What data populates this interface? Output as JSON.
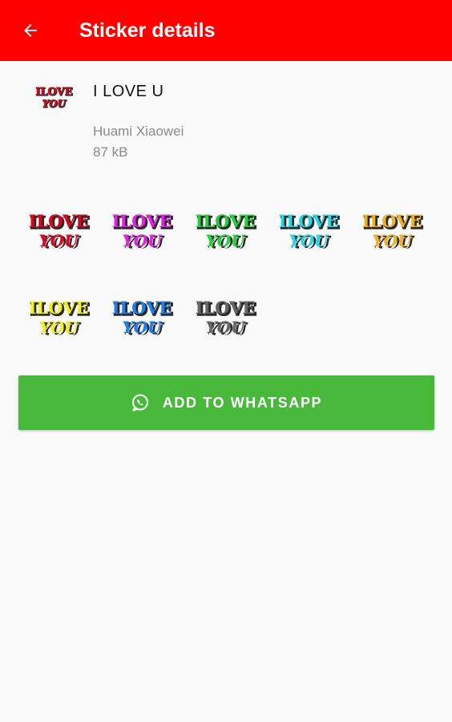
{
  "appbar": {
    "title": "Sticker details",
    "color": "#fe0000",
    "back_icon": "arrow-left-icon"
  },
  "pack": {
    "name": "I LOVE U",
    "author": "Huami Xiaowei",
    "size": "87 kB",
    "tray_icon": "i-love-you-sticker-red"
  },
  "sticker_text": {
    "line1": "ILOVE",
    "line2": "YOU"
  },
  "stickers": [
    {
      "name": "sticker-red",
      "color": "#e2001a"
    },
    {
      "name": "sticker-magenta",
      "color": "#e81ce8"
    },
    {
      "name": "sticker-green",
      "color": "#22d13a"
    },
    {
      "name": "sticker-cyan",
      "color": "#22d8e6"
    },
    {
      "name": "sticker-orange",
      "color": "#f5b022"
    },
    {
      "name": "sticker-yellow",
      "color": "#f4ee1a"
    },
    {
      "name": "sticker-blue",
      "color": "#1e7ef0"
    },
    {
      "name": "sticker-gray",
      "color": "#666666"
    }
  ],
  "add_button": {
    "label": "ADD TO WHATSAPP",
    "color": "#49b93b",
    "icon": "whatsapp-icon"
  }
}
